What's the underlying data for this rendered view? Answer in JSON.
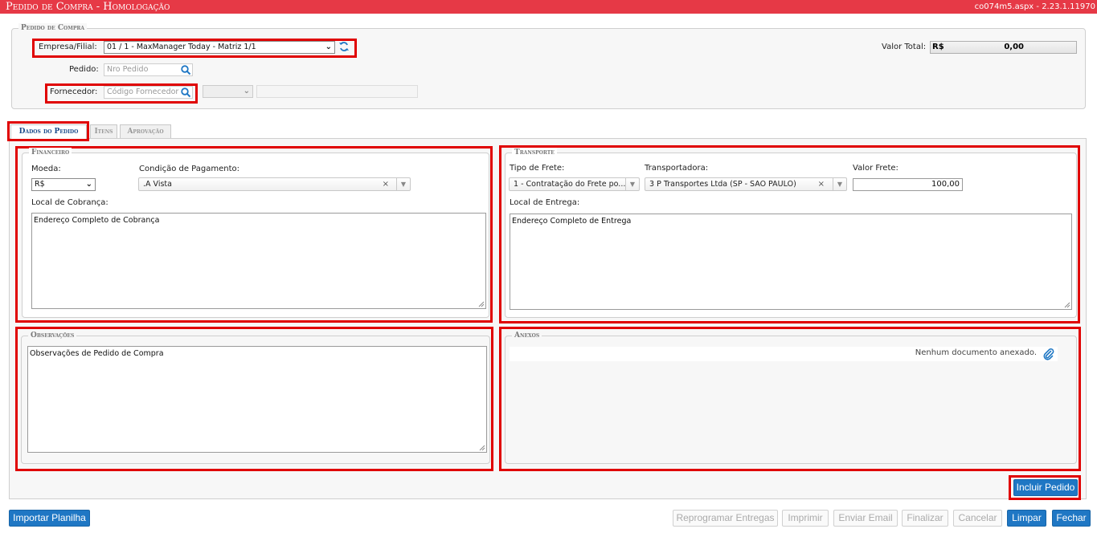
{
  "titlebar": {
    "title": "Pedido de Compra  - Homologação",
    "version": "co074m5.aspx - 2.23.1.11970"
  },
  "header": {
    "legend": "Pedido de Compra",
    "empresa_label": "Empresa/Filial:",
    "empresa_value": "01 / 1 - MaxManager Today - Matriz 1/1",
    "pedido_label": "Pedido:",
    "pedido_placeholder": "Nro Pedido",
    "fornecedor_label": "Fornecedor:",
    "fornecedor_placeholder": "Código Fornecedor",
    "valor_total_label": "Valor Total:",
    "valor_total_currency": "R$",
    "valor_total_value": "0,00"
  },
  "tabs": [
    {
      "label": "Dados do Pedido",
      "active": true
    },
    {
      "label": "Itens",
      "active": false
    },
    {
      "label": "Aprovação",
      "active": false
    }
  ],
  "financeiro": {
    "legend": "Financeiro",
    "moeda_label": "Moeda:",
    "moeda_value": "R$",
    "condicao_label": "Condição de Pagamento:",
    "condicao_value": ".A Vista",
    "local_label": "Local de Cobrança:",
    "local_value": "Endereço Completo de Cobrança"
  },
  "transporte": {
    "legend": "Transporte",
    "tipo_frete_label": "Tipo de Frete:",
    "tipo_frete_value": "1 - Contratação do Frete po...",
    "transportadora_label": "Transportadora:",
    "transportadora_value": "3 P Transportes Ltda (SP - SAO PAULO)",
    "valor_frete_label": "Valor Frete:",
    "valor_frete_value": "100,00",
    "local_label": "Local de Entrega:",
    "local_value": "Endereço Completo de Entrega"
  },
  "observacoes": {
    "legend": "Observações",
    "value": "Observações de Pedido de Compra"
  },
  "anexos": {
    "legend": "Anexos",
    "empty_text": "Nenhum documento anexado."
  },
  "buttons": {
    "incluir": "Incluir Pedido",
    "importar": "Importar Planilha",
    "reprogramar": "Reprogramar Entregas",
    "imprimir": "Imprimir",
    "enviar_email": "Enviar Email",
    "finalizar": "Finalizar",
    "cancelar": "Cancelar",
    "limpar": "Limpar",
    "fechar": "Fechar"
  },
  "colors": {
    "titlebar": "#e63946",
    "highlight": "#e00000",
    "primary_button": "#1f77c4"
  }
}
